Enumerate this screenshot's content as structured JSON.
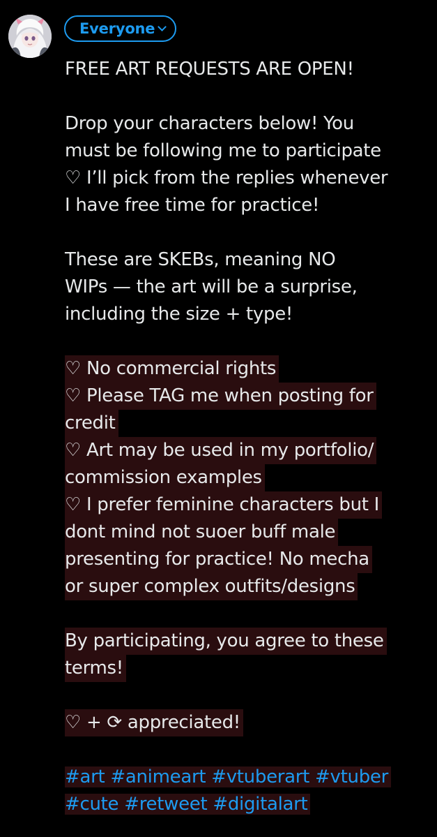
{
  "header": {
    "audience_label": "Everyone"
  },
  "colors": {
    "background": "#000000",
    "text": "#e7e9ea",
    "accent": "#1d9bf0",
    "highlight": "#2a0d0f"
  },
  "post": {
    "lines": [
      "FREE ART REQUESTS ARE OPEN!",
      "",
      "Drop your characters below! You",
      "must be following me to participate",
      "♡ I’ll pick from the replies whenever",
      "I have free time for practice!",
      "",
      "These are SKEBs, meaning NO",
      "WIPs — the art will be a surprise,",
      "including the size + type!",
      "",
      "♡ No commercial rights",
      "♡ Please TAG me when posting for",
      "credit",
      "♡ Art may be used in my portfolio/",
      "commission examples",
      "♡ I prefer feminine characters but I",
      "dont mind not suoer buff male",
      "presenting for practice! No mecha",
      "or super complex outfits/designs",
      "",
      "By participating, you agree to these",
      "terms!",
      "",
      "♡ + ⟳ appreciated!",
      ""
    ],
    "hashtag_lines": [
      [
        "#art",
        "#animeart",
        "#vtuberart",
        "#vtuber"
      ],
      [
        "#cute",
        "#retweet",
        "#digitalart"
      ]
    ]
  }
}
